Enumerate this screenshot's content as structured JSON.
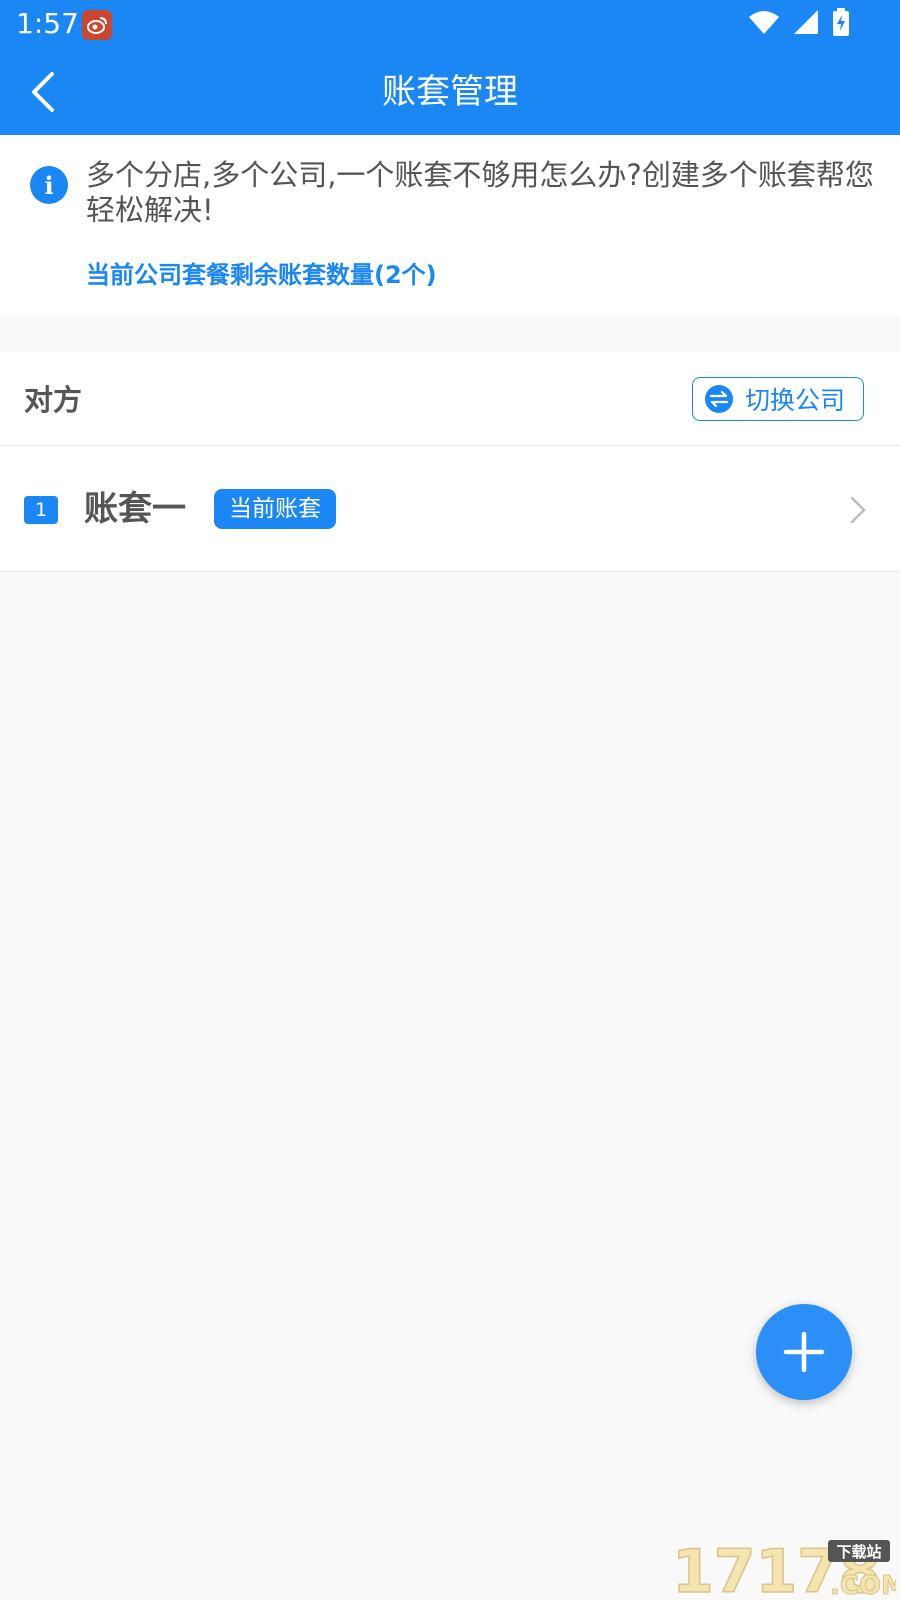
{
  "status_bar": {
    "time": "1:57",
    "notification_icon": "weibo-icon",
    "icons": [
      "wifi-icon",
      "signal-icon",
      "battery-charging-icon"
    ]
  },
  "app_bar": {
    "title": "账套管理",
    "back_icon": "chevron-left-icon"
  },
  "info": {
    "icon": "info-icon",
    "text": "多个分店,多个公司,一个账套不够用怎么办?创建多个账套帮您轻松解决!",
    "quota": "当前公司套餐剩余账套数量(2个)"
  },
  "company": {
    "name": "对方",
    "switch_label": "切换公司",
    "switch_icon": "swap-icon"
  },
  "accounts": [
    {
      "index": "1",
      "name": "账套一",
      "badge": "当前账套"
    }
  ],
  "fab": {
    "icon": "plus-icon"
  },
  "watermark": {
    "text": "17178",
    "sub": "下载站",
    "suffix": ".COM"
  },
  "colors": {
    "primary": "#1b87f5",
    "background": "#f9f9f9",
    "text": "#555555"
  }
}
